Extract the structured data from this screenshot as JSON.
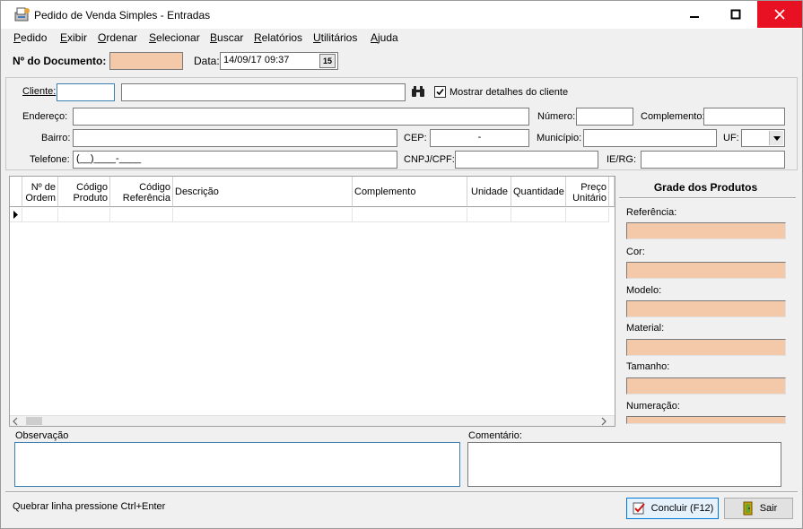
{
  "window": {
    "title": "Pedido de Venda Simples - Entradas"
  },
  "menu": [
    {
      "label": "Pedido",
      "mnemonic": "P"
    },
    {
      "label": "Exibir",
      "mnemonic": "E"
    },
    {
      "label": "Ordenar",
      "mnemonic": "O"
    },
    {
      "label": "Selecionar",
      "mnemonic": "S"
    },
    {
      "label": "Buscar",
      "mnemonic": "B"
    },
    {
      "label": "Relatórios",
      "mnemonic": "R"
    },
    {
      "label": "Utilitários",
      "mnemonic": "U"
    },
    {
      "label": "Ajuda",
      "mnemonic": "A"
    }
  ],
  "doc": {
    "number_label": "Nº do Documento:",
    "number_value": "",
    "date_label": "Data:",
    "date_value": "14/09/17 09:37",
    "calendar_btn": "15"
  },
  "client": {
    "cliente_label": "Cliente:",
    "cliente_code": "",
    "cliente_name": "",
    "show_details_label": "Mostrar detalhes do cliente",
    "show_details_checked": true,
    "endereco_label": "Endereço:",
    "numero_label": "Número:",
    "complemento_label": "Complemento:",
    "bairro_label": "Bairro:",
    "cep_label": "CEP:",
    "cep_value": "-",
    "municipio_label": "Município:",
    "uf_label": "UF:",
    "telefone_label": "Telefone:",
    "telefone_value": "(__)____-____",
    "cnpj_label": "CNPJ/CPF:",
    "ierg_label": "IE/RG:"
  },
  "grid": {
    "columns": [
      {
        "label": "Nº de Ordem",
        "align": "right"
      },
      {
        "label": "Código Produto",
        "align": "right"
      },
      {
        "label": "Código Referência",
        "align": "right"
      },
      {
        "label": "Descrição",
        "align": "left"
      },
      {
        "label": "Complemento",
        "align": "left"
      },
      {
        "label": "Unidade",
        "align": "left"
      },
      {
        "label": "Quantidade",
        "align": "left"
      },
      {
        "label": "Preço Unitário",
        "align": "right"
      }
    ]
  },
  "side": {
    "title": "Grade dos Produtos",
    "fields": [
      "Referência:",
      "Cor:",
      "Modelo:",
      "Material:",
      "Tamanho:",
      "Numeração:"
    ]
  },
  "notes": {
    "observacao_label": "Observação",
    "comentario_label": "Comentário:"
  },
  "status": {
    "hint": "Quebrar linha pressione Ctrl+Enter",
    "concluir_label": "Concluir (F12)",
    "sair_label": "Sair"
  }
}
